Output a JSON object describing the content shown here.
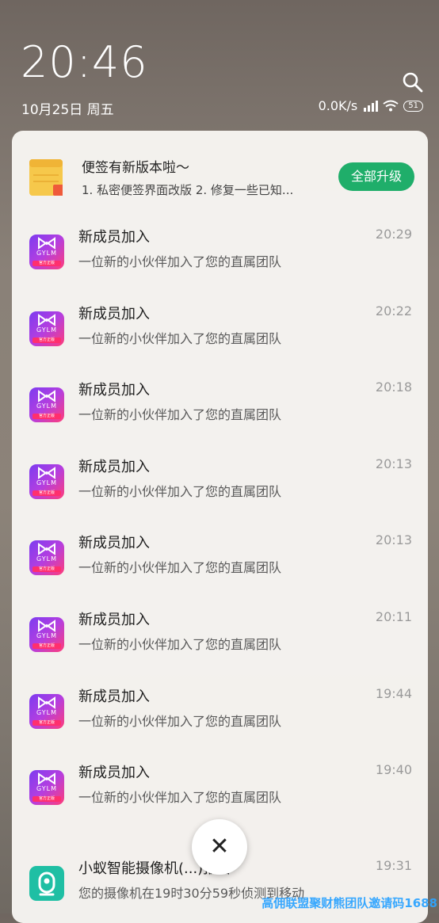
{
  "status_bar": {
    "clock": "20:46",
    "date": "10月25日 周五",
    "network_speed": "0.0K/s",
    "battery": "51",
    "icons": [
      "search-icon",
      "signal-icon",
      "wifi-icon",
      "battery-icon"
    ]
  },
  "upgrade_notification": {
    "title": "便签有新版本啦～",
    "description": "1. 私密便签界面改版 2. 修复一些已知...",
    "button_label": "全部升级",
    "button_color": "#1fae6a"
  },
  "app_icon": {
    "brand": "GYLM",
    "tag": "官方正版"
  },
  "notifications": [
    {
      "title": "新成员加入",
      "body": "一位新的小伙伴加入了您的直属团队",
      "time": "20:29"
    },
    {
      "title": "新成员加入",
      "body": "一位新的小伙伴加入了您的直属团队",
      "time": "20:22"
    },
    {
      "title": "新成员加入",
      "body": "一位新的小伙伴加入了您的直属团队",
      "time": "20:18"
    },
    {
      "title": "新成员加入",
      "body": "一位新的小伙伴加入了您的直属团队",
      "time": "20:13"
    },
    {
      "title": "新成员加入",
      "body": "一位新的小伙伴加入了您的直属团队",
      "time": "20:13"
    },
    {
      "title": "新成员加入",
      "body": "一位新的小伙伴加入了您的直属团队",
      "time": "20:11"
    },
    {
      "title": "新成员加入",
      "body": "一位新的小伙伴加入了您的直属团队",
      "time": "19:44"
    },
    {
      "title": "新成员加入",
      "body": "一位新的小伙伴加入了您的直属团队",
      "time": "19:40"
    }
  ],
  "camera_notification": {
    "title": "小蚁智能摄像机(...)报警",
    "body": "您的摄像机在19时30分59秒侦测到移动",
    "time": "19:31"
  },
  "close_button": {
    "glyph": "✕"
  },
  "watermark": "高佣联盟聚财熊团队邀请码1688"
}
